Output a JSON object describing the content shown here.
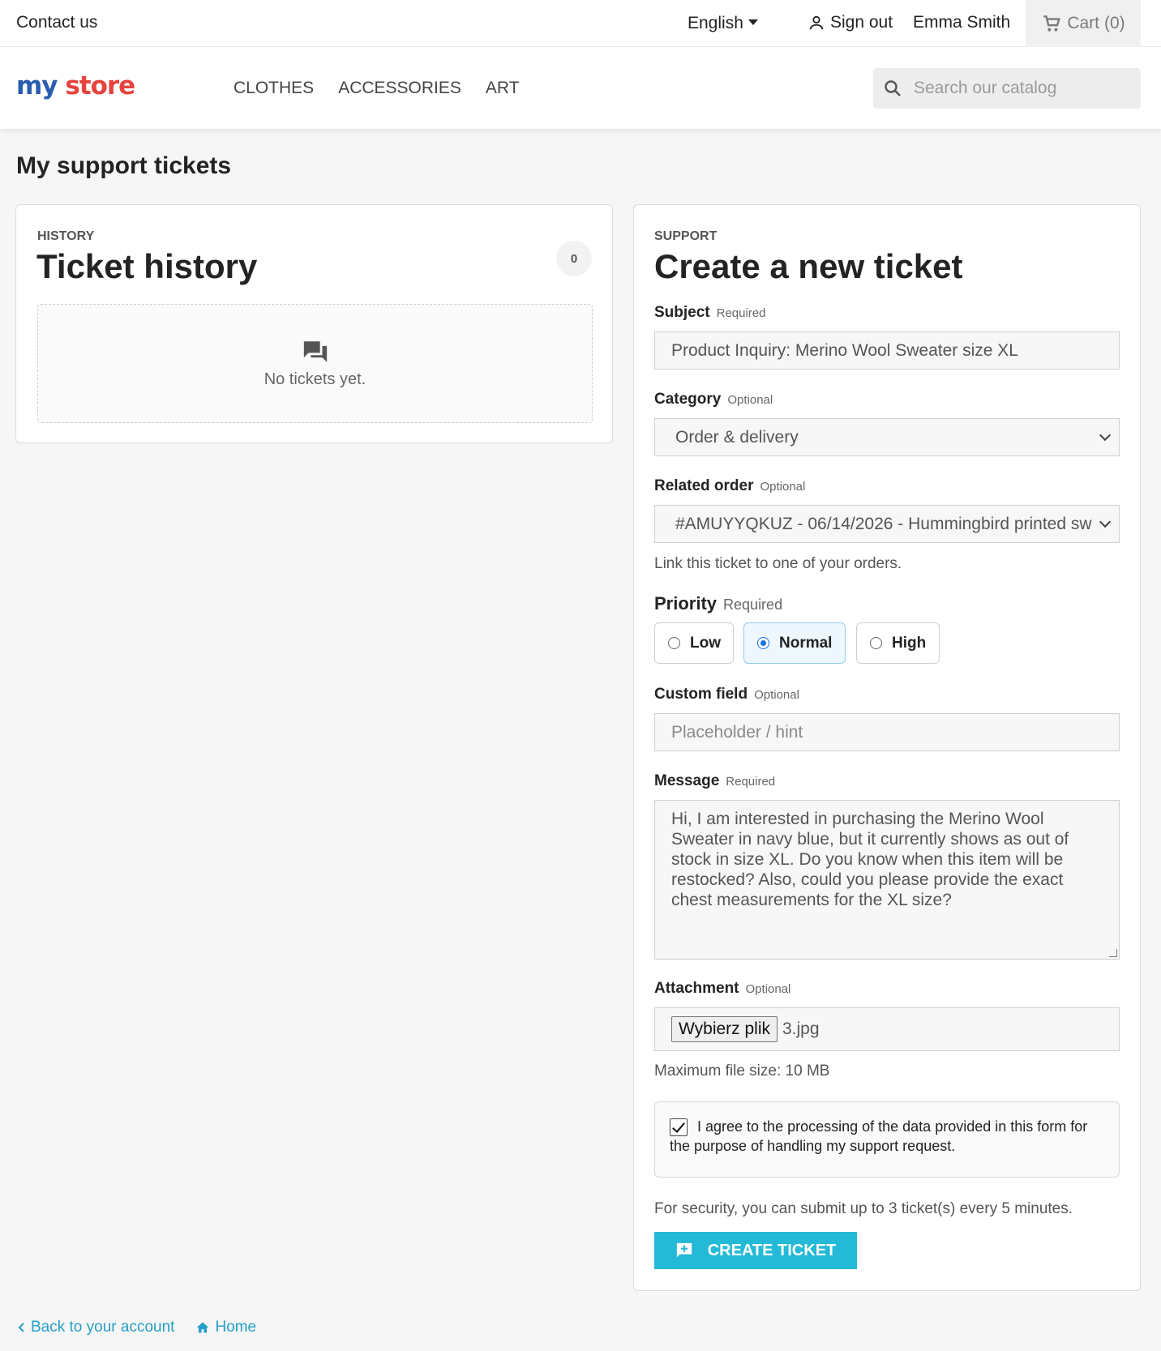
{
  "topbar": {
    "contact": "Contact us",
    "language": "English",
    "signout": "Sign out",
    "username": "Emma Smith",
    "cart": "Cart",
    "cart_count": "(0)"
  },
  "header": {
    "logo_my": "my",
    "logo_store": "store",
    "nav": [
      "CLOTHES",
      "ACCESSORIES",
      "ART"
    ],
    "search_placeholder": "Search our catalog"
  },
  "page": {
    "title": "My support tickets"
  },
  "history": {
    "eyebrow": "HISTORY",
    "title": "Ticket history",
    "count": "0",
    "empty_text": "No tickets yet."
  },
  "form": {
    "eyebrow": "SUPPORT",
    "title": "Create a new ticket",
    "subject": {
      "label": "Subject",
      "hint": "Required",
      "value": "Product Inquiry: Merino Wool Sweater size XL"
    },
    "category": {
      "label": "Category",
      "hint": "Optional",
      "value": "Order & delivery"
    },
    "related_order": {
      "label": "Related order",
      "hint": "Optional",
      "value": "#AMUYYQKUZ - 06/14/2026 - Hummingbird printed sw",
      "help": "Link this ticket to one of your orders."
    },
    "priority": {
      "label": "Priority",
      "hint": "Required",
      "options": [
        "Low",
        "Normal",
        "High"
      ],
      "selected": "Normal"
    },
    "custom_field": {
      "label": "Custom field",
      "hint": "Optional",
      "placeholder": "Placeholder / hint"
    },
    "message": {
      "label": "Message",
      "hint": "Required",
      "value": "Hi, I am interested in purchasing the Merino Wool Sweater in navy blue, but it currently shows as out of stock in size XL. Do you know when this item will be restocked? Also, could you please provide the exact chest measurements for the XL size?"
    },
    "attachment": {
      "label": "Attachment",
      "hint": "Optional",
      "button": "Wybierz plik",
      "filename": "3.jpg",
      "help": "Maximum file size: 10 MB"
    },
    "consent": "I agree to the processing of the data provided in this form for the purpose of handling my support request.",
    "security_note": "For security, you can submit up to 3 ticket(s) every 5 minutes.",
    "submit": "CREATE TICKET"
  },
  "footer": {
    "back": "Back to your account",
    "home": "Home"
  },
  "colors": {
    "accent": "#24b9d7",
    "link": "#24a0c6",
    "logo_blue": "#2a5db0",
    "logo_red": "#e6433f"
  }
}
